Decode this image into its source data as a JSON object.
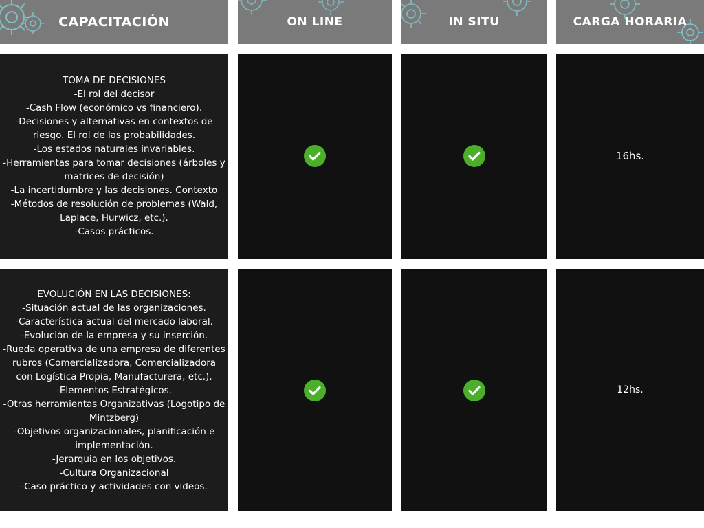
{
  "header": {
    "capacitacion": "CAPACITACIÓN",
    "online": "ON LINE",
    "insitu": "IN SITU",
    "carga": "CARGA HORARIA"
  },
  "rows": [
    {
      "course": "TOMA DE DECISIONES\n-El rol del decisor\n-Cash Flow (económico vs financiero).\n-Decisiones y  alternativas en contextos de riesgo. El rol de las probabilidades.\n-Los estados naturales invariables.\n-Herramientas para tomar decisiones (árboles y matrices de decisión)\n-La incertidumbre y las decisiones. Contexto\n-Métodos de resolución de problemas (Wald, Laplace, Hurwicz, etc.).\n-Casos prácticos.",
      "online": true,
      "insitu": true,
      "hours": "16hs."
    },
    {
      "course": "EVOLUCIÓN EN LAS DECISIONES:\n-Situación actual de las organizaciones.\n-Característica actual del mercado laboral.\n-Evolución de la empresa y su inserción.\n-Rueda operativa de una empresa de diferentes rubros (Comercializadora, Comercializadora con Logística Propia, Manufacturera, etc.).\n-Elementos Estratégicos.\n-Otras herramientas Organizativas (Logotipo de Mintzberg)\n-Objetivos organizacionales, planificación e implementación.\n-Jerarquia en los objetivos.\n-Cultura Organizacional\n-Caso práctico y actividades con videos.",
      "online": true,
      "insitu": true,
      "hours": "12hs."
    }
  ],
  "colors": {
    "header_bg": "#7a7a7a",
    "cell_bg": "#1c1c1c",
    "check_green": "#4caf2a",
    "gear_teal": "#7fd8e0"
  },
  "icons": {
    "check": "check-circle-icon",
    "gear": "gear-icon"
  }
}
